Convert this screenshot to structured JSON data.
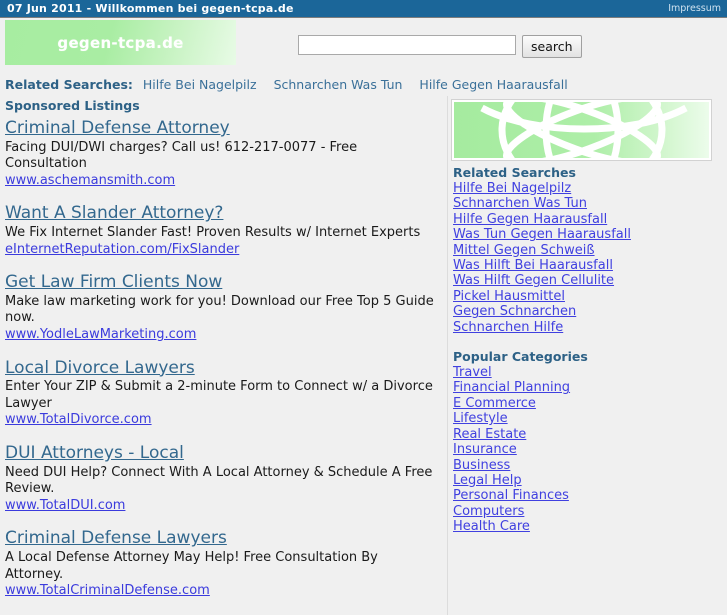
{
  "topbar": {
    "title": "07 Jun 2011 - Willkommen bei gegen-tcpa.de",
    "impressum_label": "Impressum"
  },
  "header": {
    "logo_text": "gegen-tcpa.de",
    "search_value": "",
    "search_placeholder": "",
    "search_button_label": "search"
  },
  "related_strip": {
    "label": "Related Searches:",
    "items": [
      "Hilfe Bei Nagelpilz",
      "Schnarchen Was Tun",
      "Hilfe Gegen Haarausfall"
    ]
  },
  "main": {
    "sponsored_heading": "Sponsored Listings",
    "ads": [
      {
        "title": "Criminal Defense Attorney",
        "desc": "Facing DUI/DWI charges? Call us! 612-217-0077 - Free Consultation",
        "url": "www.aschemansmith.com"
      },
      {
        "title": "Want A Slander Attorney?",
        "desc": "We Fix Internet Slander Fast! Proven Results w/ Internet Experts",
        "url": "eInternetReputation.com/FixSlander"
      },
      {
        "title": "Get Law Firm Clients Now",
        "desc": "Make law marketing work for you! Download our Free Top 5 Guide now.",
        "url": "www.YodleLawMarketing.com"
      },
      {
        "title": "Local Divorce Lawyers",
        "desc": "Enter Your ZIP & Submit a 2-minute Form to Connect w/ a Divorce Lawyer",
        "url": "www.TotalDivorce.com"
      },
      {
        "title": "DUI Attorneys - Local",
        "desc": "Need DUI Help? Connect With A Local Attorney & Schedule A Free Review.",
        "url": "www.TotalDUI.com"
      },
      {
        "title": "Criminal Defense Lawyers",
        "desc": "A Local Defense Attorney May Help! Free Consultation By Attorney.",
        "url": "www.TotalCriminalDefense.com"
      }
    ]
  },
  "sidebar": {
    "banner_icon": "green-globe-banner",
    "related_heading": "Related Searches",
    "related_items": [
      "Hilfe Bei Nagelpilz",
      "Schnarchen Was Tun",
      "Hilfe Gegen Haarausfall",
      "Was Tun Gegen Haarausfall",
      "Mittel Gegen Schweiß",
      "Was Hilft Bei Haarausfall",
      "Was Hilft Gegen Cellulite",
      "Pickel Hausmittel",
      "Gegen Schnarchen",
      "Schnarchen Hilfe"
    ],
    "categories_heading": "Popular Categories",
    "category_items": [
      "Travel",
      "Financial Planning",
      "E Commerce",
      "Lifestyle",
      "Real Estate",
      "Insurance",
      "Business",
      "Legal Help",
      "Personal Finances",
      "Computers",
      "Health Care"
    ]
  },
  "colors": {
    "topbar_blue": "#1b6699",
    "heading_blue": "#2d6186",
    "ad_title_blue": "#33688e",
    "link_blue": "#4040e0",
    "logo_green": "#a7eda1",
    "page_bg": "#f0f0f0"
  }
}
